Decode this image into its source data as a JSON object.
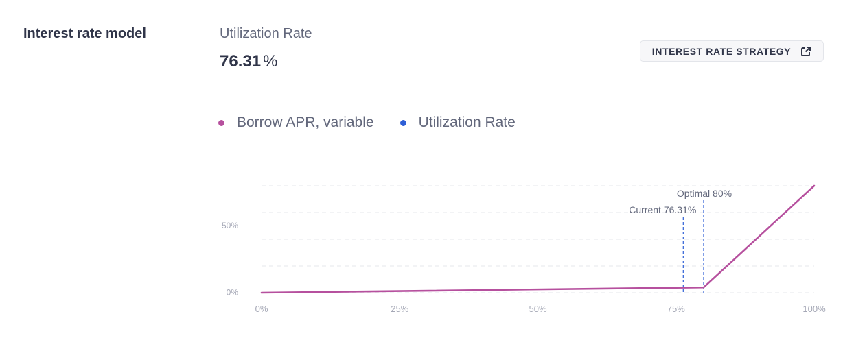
{
  "section": {
    "title": "Interest rate model"
  },
  "utilization": {
    "label": "Utilization Rate",
    "value": "76.31",
    "unit": "%"
  },
  "strategy_button": {
    "label": "INTEREST RATE STRATEGY",
    "icon": "external-link-icon"
  },
  "legend": [
    {
      "label": "Borrow APR, variable",
      "color": "#b6509e"
    },
    {
      "label": "Utilization Rate",
      "color": "#2e5fd6"
    }
  ],
  "chart_data": {
    "type": "line",
    "series": [
      {
        "name": "Borrow APR, variable",
        "color": "#b6509e",
        "x": [
          0,
          80,
          100
        ],
        "y": [
          0,
          4,
          80
        ]
      }
    ],
    "xlim": [
      0,
      100
    ],
    "ylim": [
      0,
      80
    ],
    "x_ticks": [
      {
        "value": 0,
        "label": "0%"
      },
      {
        "value": 25,
        "label": "25%"
      },
      {
        "value": 50,
        "label": "50%"
      },
      {
        "value": 75,
        "label": "75%"
      },
      {
        "value": 100,
        "label": "100%"
      }
    ],
    "y_ticks": [
      {
        "value": 0,
        "label": "0%"
      },
      {
        "value": 50,
        "label": "50%"
      }
    ],
    "gridlines_y": [
      0,
      20,
      40,
      60,
      80
    ],
    "grid": true,
    "annotations": [
      {
        "x": 80,
        "label": "Optimal 80%",
        "color": "#2e5fd6"
      },
      {
        "x": 76.31,
        "label": "Current 76.31%",
        "color": "#2e5fd6"
      }
    ]
  }
}
